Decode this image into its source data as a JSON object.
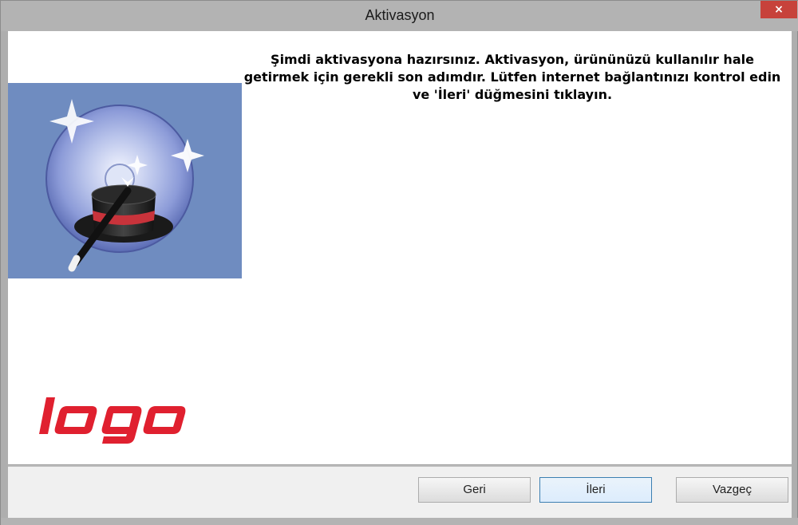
{
  "window": {
    "title": "Aktivasyon",
    "close_label": "×"
  },
  "main": {
    "message": "Şimdi aktivasyona hazırsınız. Aktivasyon, ürününüzü kullanılır hale getirmek için gerekli son adımdır. Lütfen internet bağlantınızı kontrol edin ve 'İleri' düğmesini tıklayın.",
    "logo_text": "logo",
    "banner_icon": "cd-magic-hat-icon"
  },
  "footer": {
    "back_label": "Geri",
    "next_label": "İleri",
    "cancel_label": "Vazgeç"
  },
  "colors": {
    "brand_red": "#e0202f",
    "banner_bg": "#6f8cc0",
    "close_bg": "#c7423b"
  }
}
